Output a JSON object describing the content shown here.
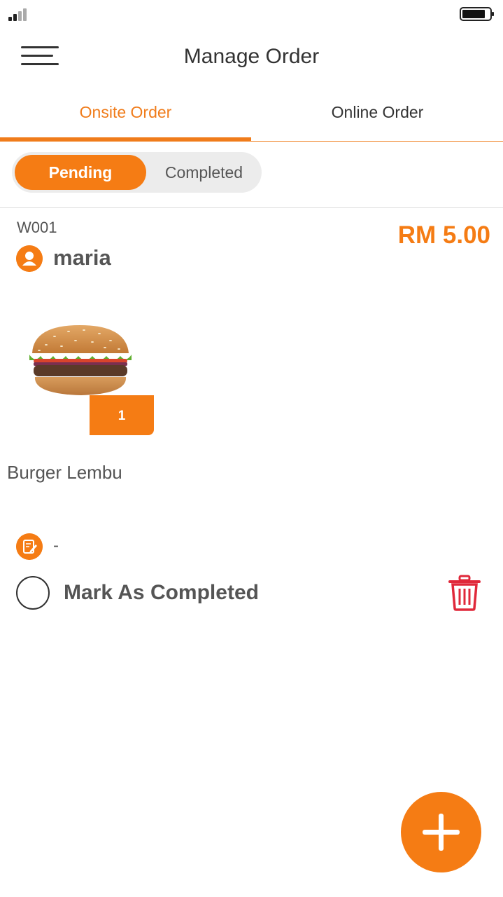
{
  "header": {
    "title": "Manage Order"
  },
  "tabs": [
    {
      "label": "Onsite Order",
      "active": true
    },
    {
      "label": "Online Order",
      "active": false
    }
  ],
  "status_segment": [
    {
      "label": "Pending",
      "active": true
    },
    {
      "label": "Completed",
      "active": false
    }
  ],
  "order": {
    "code": "W001",
    "price": "RM 5.00",
    "customer": "maria",
    "item": {
      "name": "Burger Lembu",
      "quantity": "1",
      "image": "burger-image"
    },
    "note": "-",
    "mark_label": "Mark As Completed"
  },
  "colors": {
    "accent": "#f57c14",
    "delete": "#e0283a",
    "text": "#555555"
  },
  "icons": {
    "menu": "hamburger-menu-icon",
    "user": "user-icon",
    "note": "note-edit-icon",
    "delete": "trash-icon",
    "add": "plus-icon"
  }
}
